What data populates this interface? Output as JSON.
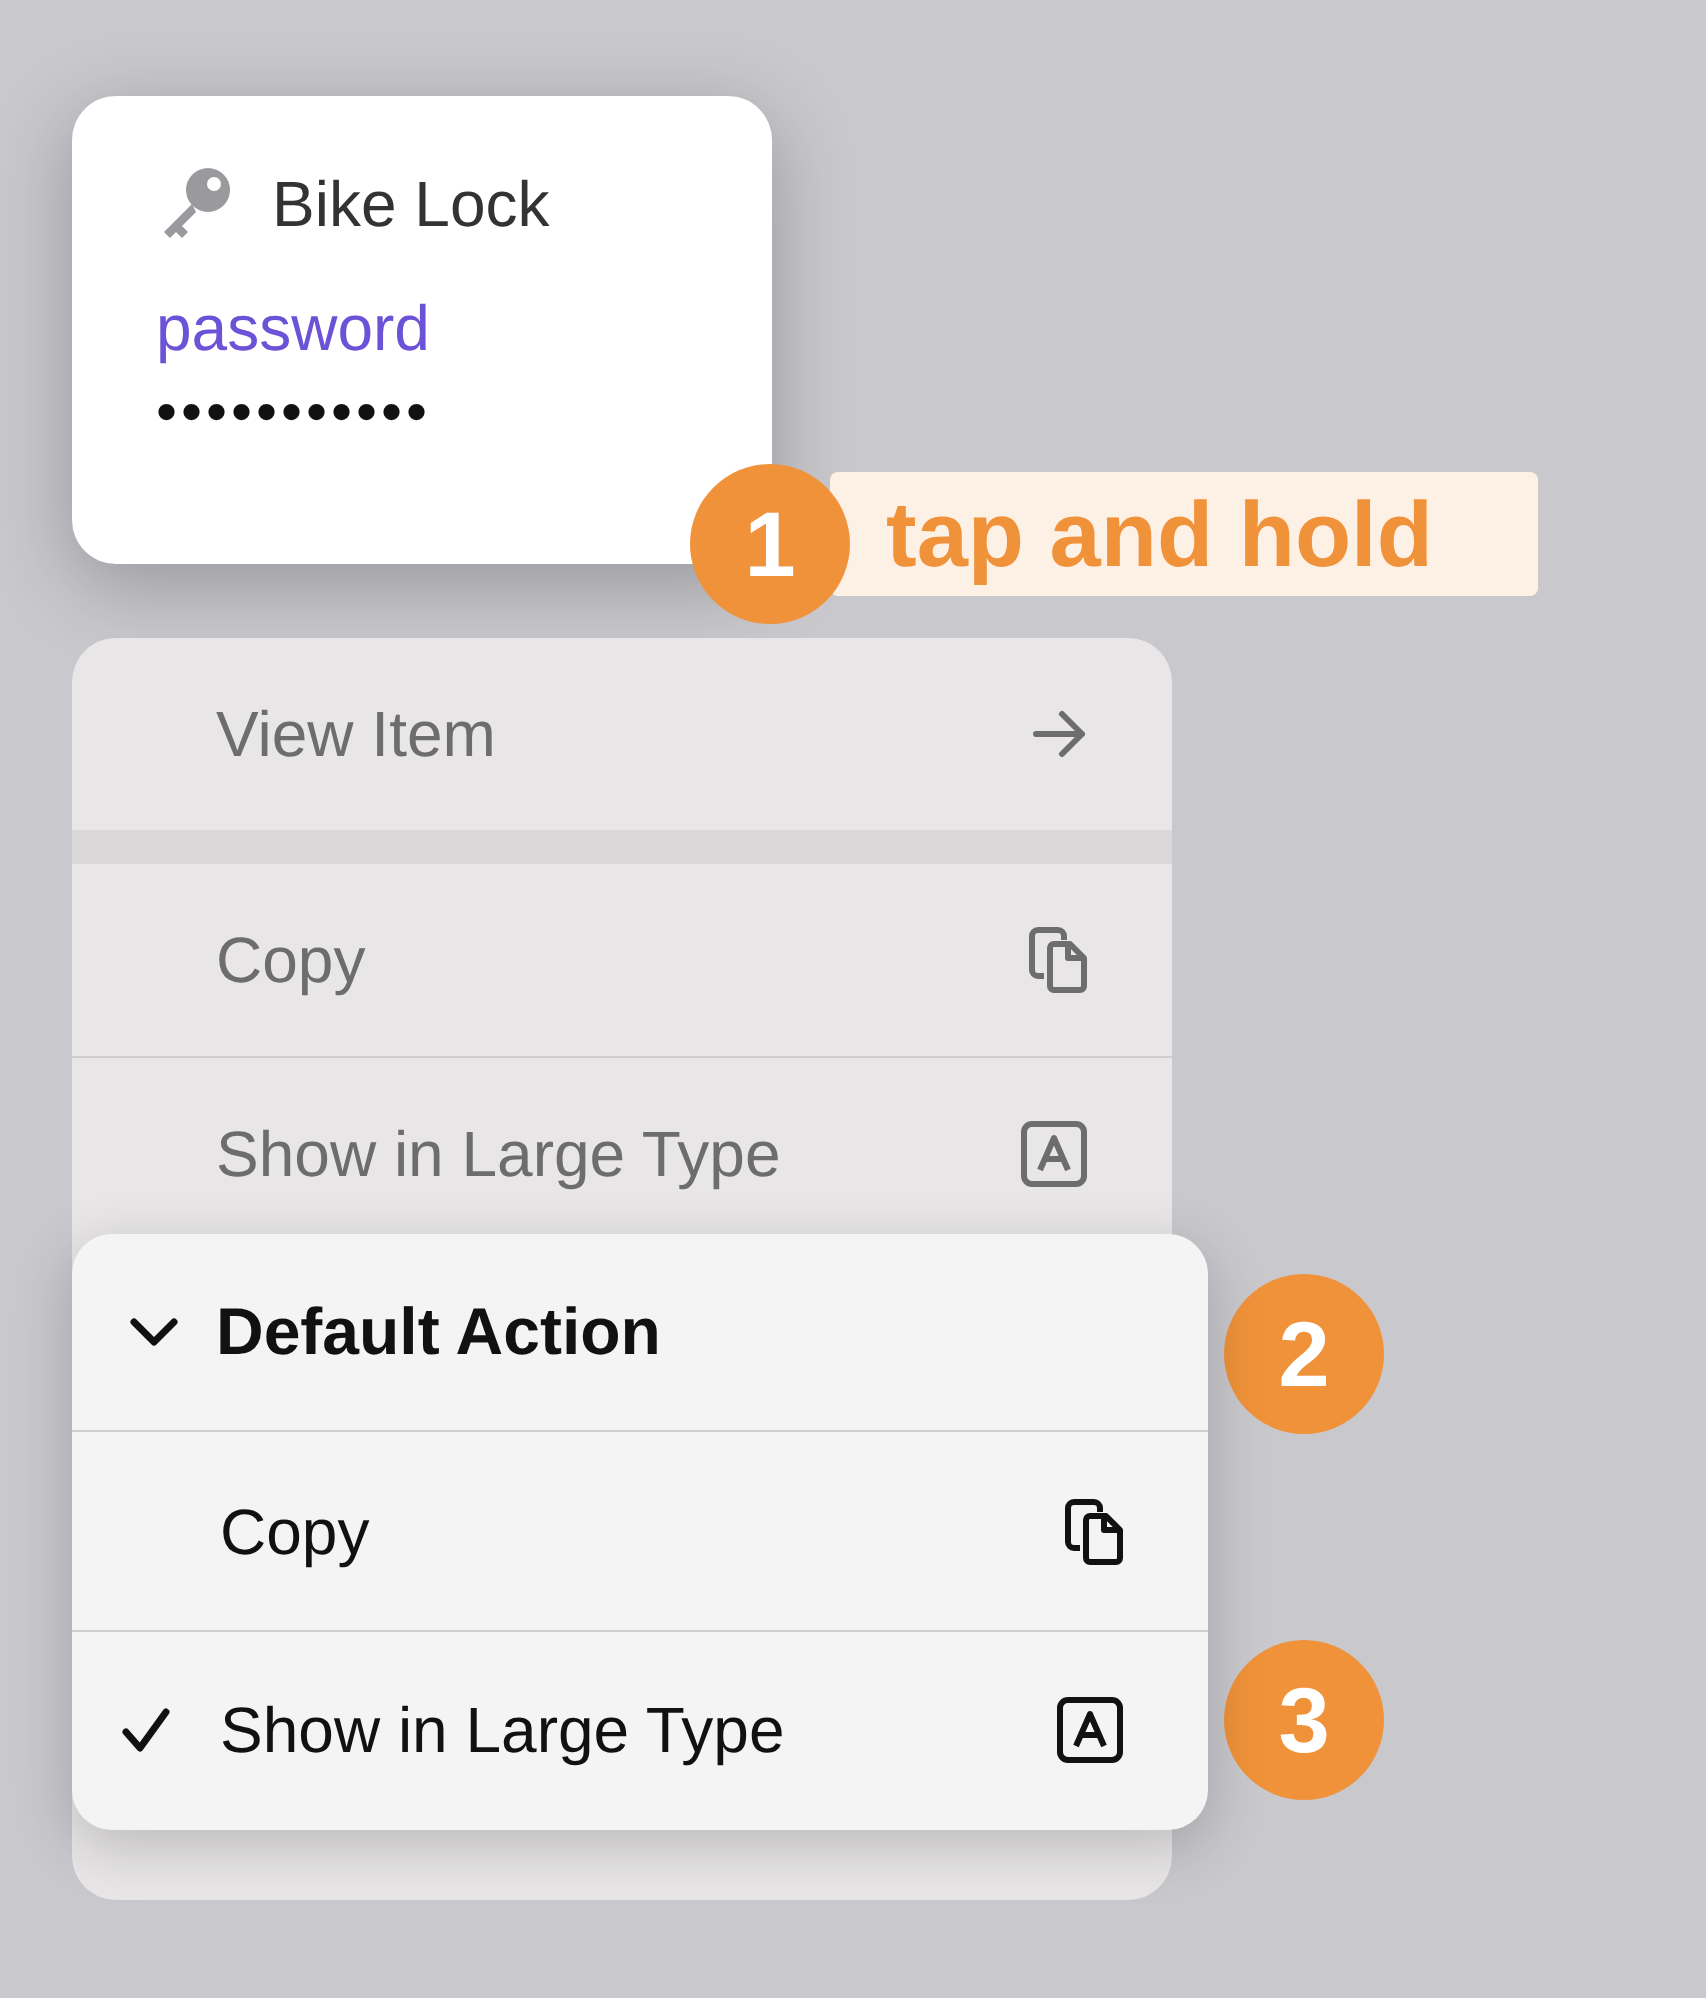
{
  "card": {
    "title": "Bike Lock",
    "field_label": "password",
    "field_value": "•••••••••••"
  },
  "callouts": [
    {
      "number": "1",
      "label": "tap and hold"
    },
    {
      "number": "2"
    },
    {
      "number": "3"
    }
  ],
  "menu": {
    "sections": [
      [
        {
          "label": "View Item",
          "kind": "arrow"
        }
      ],
      [
        {
          "label": "Copy",
          "kind": "copy"
        },
        {
          "label": "Show in Large Type",
          "kind": "large_type"
        }
      ]
    ]
  },
  "submenu": {
    "title": "Default Action",
    "expanded": true,
    "items": [
      {
        "label": "Copy",
        "kind": "copy",
        "checked": false
      },
      {
        "label": "Show in Large Type",
        "kind": "large_type",
        "checked": true
      }
    ]
  }
}
